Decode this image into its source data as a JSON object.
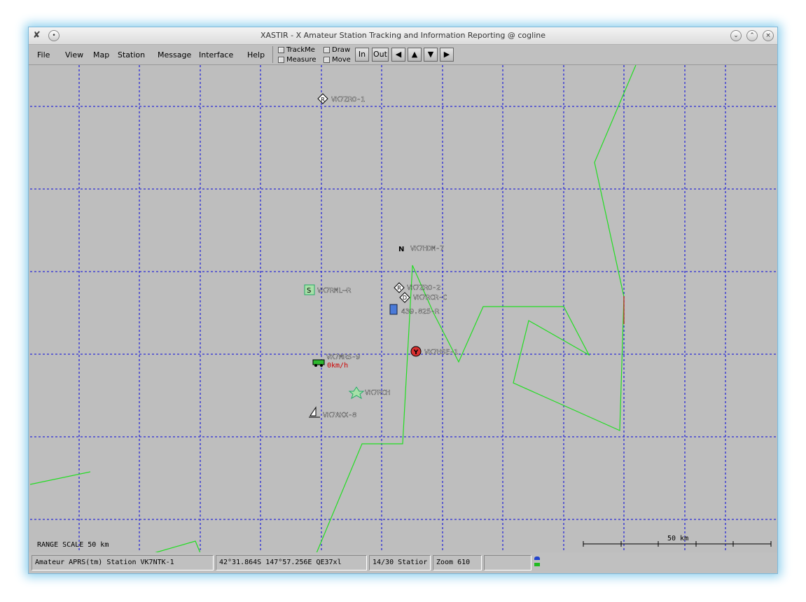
{
  "window": {
    "title": "XASTIR - X Amateur Station Tracking and Information Reporting @ cogline"
  },
  "menu": {
    "file": "File",
    "view": "View",
    "map": "Map",
    "station": "Station",
    "message": "Message",
    "interface": "Interface",
    "help": "Help"
  },
  "toggles": {
    "trackme": "TrackMe",
    "draw": "Draw",
    "measure": "Measure",
    "move": "Move"
  },
  "buttons": {
    "zoom_in": "In",
    "zoom_out": "Out"
  },
  "map": {
    "range_scale": "RANGE SCALE 50 km",
    "scale_bar": "50 km",
    "stations": [
      {
        "callsign": "VK7ZRO-1",
        "symbol": "R"
      },
      {
        "callsign": "VK7HDM-7",
        "symbol": "N"
      },
      {
        "callsign": "VK7RML~R",
        "symbol": "S"
      },
      {
        "callsign": "VK7ZRO-2",
        "symbol": "R"
      },
      {
        "callsign": "VK7RCR-C",
        "symbol": "D"
      },
      {
        "callsign": "439.825-R",
        "symbol": "tower"
      },
      {
        "callsign": "VK7HSE-1",
        "symbol": "Y"
      },
      {
        "callsign": "VK7MRS-9",
        "symbol": "car",
        "speed": "0km/h"
      },
      {
        "callsign": "VK7RCH",
        "symbol": "S"
      },
      {
        "callsign": "VK7AKX-8",
        "symbol": "boat"
      }
    ],
    "colors": {
      "grid": "#2b2bd6",
      "track": "#22dd22",
      "background": "#bebebe"
    }
  },
  "status": {
    "message": "Amateur APRS(tm) Station VK7NTK-1",
    "position": "42°31.864S  147°57.256E  QE37xl",
    "stations": "14/30 Statior",
    "zoom": "Zoom 610"
  }
}
